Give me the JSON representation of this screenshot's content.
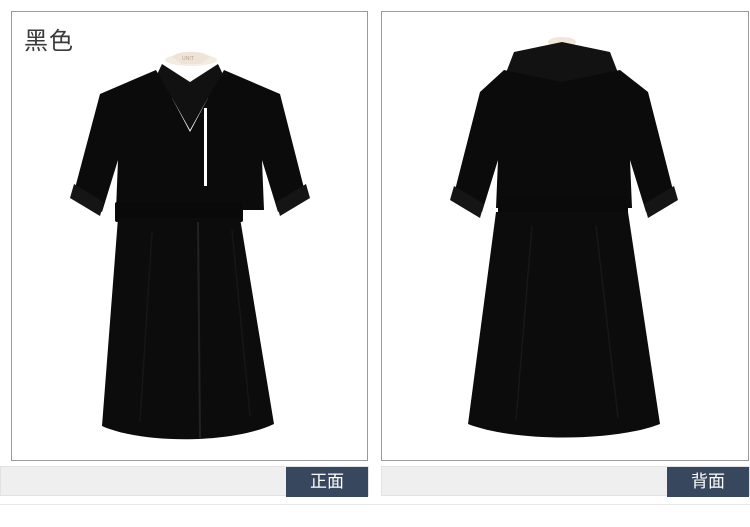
{
  "color_label": "黑色",
  "views": [
    {
      "label": "正面"
    },
    {
      "label": "背面"
    }
  ],
  "colors": {
    "dress": "#0b0b0b",
    "caption_tag": "#37475d",
    "caption_bar": "#efefef",
    "border": "#9a9a9a"
  },
  "brand_tag": "UNIT"
}
